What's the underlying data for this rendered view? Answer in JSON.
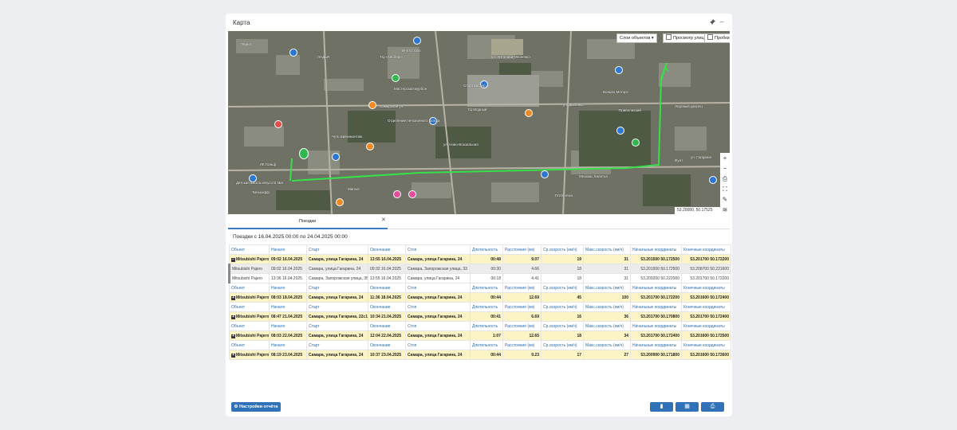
{
  "panel": {
    "title": "Карта",
    "icons": {
      "pin": "pin-icon",
      "minimize": "minimize-icon"
    }
  },
  "map": {
    "layers_dropdown": "Слои объектов",
    "street_view": "Просмотр улиц",
    "traffic": "Пробки",
    "coords": "53.20080, 50.17525",
    "labels": [
      "Ладья",
      "ЛАДЬЯ",
      "Ингосстрах",
      "Мастерская Бурбон",
      "Отделение пенсионного фонда",
      "Спортмастер",
      "ТЦ Модный",
      "Вольво Моторс",
      "Приволжский",
      "Фунт",
      "ул. Гагарина",
      "ул. Дыбенко",
      "ул. Антонова-Овсеенко",
      "Чуть Шиномонтаж",
      "ТЦ «Айсберг»",
      "ЛК Гольф",
      "Самарская ул.",
      "ул. Ново-Вокзальная",
      "Тинькофф",
      "Детская школа искусств №3",
      "Мехмаш Капитал",
      "Ледовый дворец",
      "Пятёрочка",
      "Магнит"
    ]
  },
  "tabs": [
    {
      "label": "Поездки"
    }
  ],
  "trips_title": "Поездки с 16.04.2025 00:00 по 24.04.2025 00:00",
  "columns": [
    "Объект",
    "Начало",
    "Старт",
    "Окончание",
    "Стоп",
    "Длительность",
    "Расстояние (км)",
    "Ср.скорость (км/ч)",
    "Макс.скорость (км/ч)",
    "Начальные координаты",
    "Конечные координаты"
  ],
  "rows": [
    {
      "type": "head"
    },
    {
      "type": "group",
      "cells": [
        "Mitsubishi Pajero",
        "09:02 16.04.2025",
        "Самара, улица Гагарина, 24",
        "13:55 16.04.2025",
        "Самара, улица Гагарина, 24",
        "00:48",
        "9.07",
        "19",
        "31",
        "53.201500 50.172500",
        "53.201700 50.172200"
      ]
    },
    {
      "type": "sub",
      "cells": [
        "Mitsubishi Pajero",
        "09:02 16.04.2025",
        "Самара, улица Гагарина, 24",
        "09:32 16.04.2025",
        "Самара, Запорожская улица, 33",
        "00:30",
        "4.66",
        "18",
        "31",
        "53.201500 50.172500",
        "53.208700 50.221600"
      ]
    },
    {
      "type": "sub2",
      "cells": [
        "Mitsubishi Pajero",
        "13:36 16.04.2025",
        "Самара, Запорожская улица, 35",
        "13:55 16.04.2025",
        "Самара, улица Гагарина, 24",
        "00:18",
        "4.41",
        "18",
        "31",
        "53.209200 50.222000",
        "53.201700 50.172200"
      ]
    },
    {
      "type": "head"
    },
    {
      "type": "group",
      "cells": [
        "Mitsubishi Pajero",
        "08:03 18.04.2025",
        "Самара, улица Гагарина, 24",
        "11:36 18.04.2025",
        "Самара, улица Гагарина, 24",
        "00:44",
        "12.69",
        "45",
        "100",
        "53.201700 50.172200",
        "53.201600 50.172400"
      ]
    },
    {
      "type": "head"
    },
    {
      "type": "group",
      "cells": [
        "Mitsubishi Pajero",
        "08:47 21.04.2025",
        "Самара, улица Гагарина, 22с1",
        "10:34 21.04.2025",
        "Самара, улица Гагарина, 24",
        "00:41",
        "6.69",
        "16",
        "36",
        "53.201700 50.170800",
        "53.201700 50.172400"
      ]
    },
    {
      "type": "head"
    },
    {
      "type": "group",
      "cells": [
        "Mitsubishi Pajero",
        "08:03 22.04.2025",
        "Самара, улица Гагарина, 24",
        "12:04 22.04.2025",
        "Самара, улица Гагарина, 24",
        "1:07",
        "12.65",
        "18",
        "34",
        "53.201700 50.172400",
        "53.201600 50.172500"
      ]
    },
    {
      "type": "head"
    },
    {
      "type": "group",
      "cells": [
        "Mitsubishi Pajero",
        "08:19 23.04.2025",
        "Самара, улица Гагарина, 24",
        "10:37 23.04.2025",
        "Самара, улица Гагарина, 24",
        "00:44",
        "9.23",
        "17",
        "27",
        "53.200900 50.171800",
        "53.201600 50.172600"
      ]
    }
  ],
  "footer": {
    "settings_button": "Настройки отчёта",
    "icons": [
      "document-icon",
      "spreadsheet-icon",
      "print-icon"
    ]
  },
  "colors": {
    "accent": "#2f72b8",
    "highlight": "#fcf4c4",
    "route": "#37e04a"
  }
}
